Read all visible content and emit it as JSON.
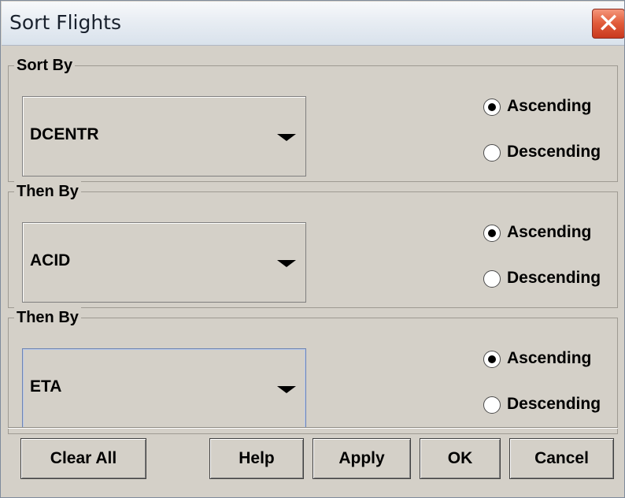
{
  "window": {
    "title": "Sort Flights",
    "close_glyph": "✕"
  },
  "groups": [
    {
      "label": "Sort By",
      "field": {
        "value": "DCENTR",
        "focused": false
      },
      "order": {
        "selected": "Ascending",
        "options": [
          "Ascending",
          "Descending"
        ]
      }
    },
    {
      "label": "Then By",
      "field": {
        "value": "ACID",
        "focused": false
      },
      "order": {
        "selected": "Ascending",
        "options": [
          "Ascending",
          "Descending"
        ]
      }
    },
    {
      "label": "Then By",
      "field": {
        "value": "ETA",
        "focused": true
      },
      "order": {
        "selected": "Ascending",
        "options": [
          "Ascending",
          "Descending"
        ]
      }
    }
  ],
  "buttons": {
    "clear_all": "Clear All",
    "help": "Help",
    "apply": "Apply",
    "ok": "OK",
    "cancel": "Cancel"
  },
  "icons": {
    "close": "close-icon",
    "dropdown": "chevron-down-icon"
  },
  "colors": {
    "dialog_background": "#d4d0c8",
    "close_button": "#e15c3b",
    "focus_border": "#6f85b3"
  }
}
